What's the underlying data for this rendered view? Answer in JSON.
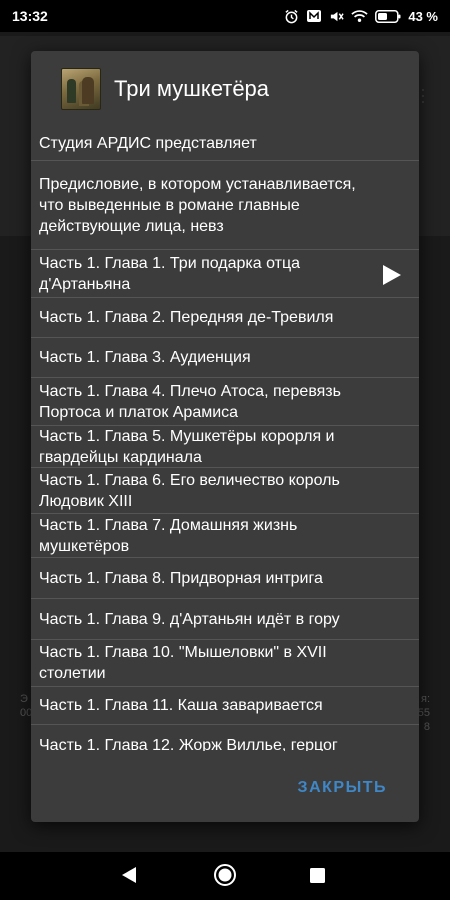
{
  "status_bar": {
    "time": "13:32",
    "battery_percent": "43 %",
    "icons": [
      "alarm-icon",
      "message-icon",
      "mute-icon",
      "wifi-icon",
      "battery-icon"
    ]
  },
  "dialog": {
    "title": "Три мушкетёра",
    "cover_icon": "book-cover-icon",
    "items": [
      "Студия АРДИС представляет",
      "Предисловие, в котором устанавливается, что выведенные в романе главные действующие лица, невз",
      "Часть 1. Глава 1. Три подарка отца д'Артаньяна",
      "Часть 1. Глава 2. Передняя де-Тревиля",
      "Часть 1. Глава 3. Аудиенция",
      "Часть 1. Глава 4. Плечо Атоса, перевязь Портоса и платок Арамиса",
      "Часть 1. Глава 5. Мушкетёры корорля и гвардейцы кардинала",
      "Часть 1. Глава 6. Его величество король Людовик XIII",
      "Часть 1. Глава 7. Домашняя жизнь мушкетёров",
      "Часть 1. Глава 8. Придворная интрига",
      "Часть 1. Глава 9. д'Артаньян идёт в гору",
      "Часть 1. Глава 10. \"Мышеловки\" в XVII столетии",
      "Часть 1. Глава 11. Каша заваривается",
      "Часть 1. Глава 12. Жорж Вилльe, герцог"
    ],
    "playing_index": 2,
    "close_label": "ЗАКРЫТЬ"
  },
  "colors": {
    "dialog_background": "#3c3c3c",
    "accent": "#3f87c6",
    "text": "#ffffff",
    "divider": "#555555"
  },
  "nav_bar": {
    "icons": [
      "back-icon",
      "home-icon",
      "recent-apps-icon"
    ]
  }
}
